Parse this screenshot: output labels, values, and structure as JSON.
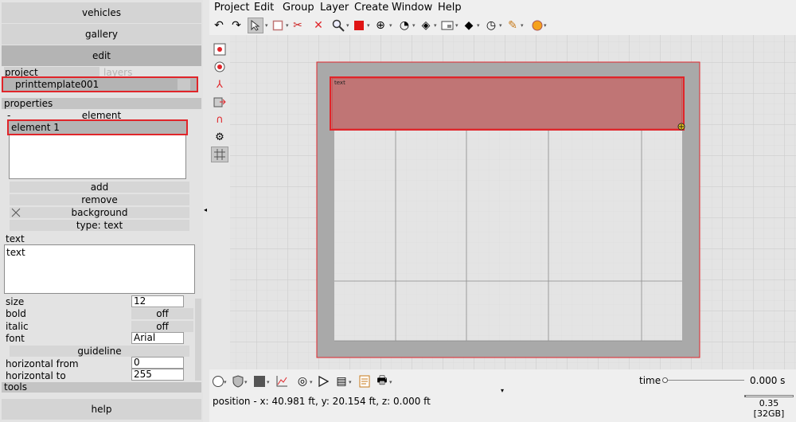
{
  "left_panel": {
    "nav": {
      "vehicles": "vehicles",
      "gallery": "gallery",
      "edit": "edit",
      "help": "help"
    },
    "tabs": {
      "project": "project",
      "layers": "layers"
    },
    "project_item": "printtemplate001",
    "properties": {
      "header": "properties",
      "element_col_prefix": "-",
      "element_col_title": "element",
      "selected_element": "element 1",
      "add_label": "add",
      "remove_label": "remove",
      "background_label": "background",
      "type_label": "type: text",
      "text_label": "text",
      "text_value": "text",
      "size_label": "size",
      "size_value": "12",
      "bold_label": "bold",
      "bold_value": "off",
      "italic_label": "italic",
      "italic_value": "off",
      "font_label": "font",
      "font_value": "Arial",
      "guideline_label": "guideline",
      "hfrom_label": "horizontal from",
      "hfrom_value": "0",
      "hto_label": "horizontal to",
      "hto_value": "255"
    },
    "tools_header": "tools"
  },
  "menu": [
    "Project",
    "Edit",
    "Group",
    "Layer",
    "Create",
    "Window",
    "Help"
  ],
  "toolbar_icons": [
    "undo-icon",
    "redo-icon",
    "select-arrow-icon",
    "rectangle-tool-icon",
    "cut-tool-icon",
    "delete-icon",
    "zoom-icon",
    "color-swatch-icon",
    "move-icon",
    "rotate-icon",
    "align-icon",
    "frame-icon",
    "ruler-icon",
    "measure-icon",
    "pencil-icon",
    "help-icon"
  ],
  "colors": {
    "accent": "#f5a11c",
    "selection_red": "#e0252a",
    "element_fill": "#c07575",
    "page_frame": "#a9a9a9"
  },
  "viewport": {
    "element_text": "text"
  },
  "bottom": {
    "time_label": "time",
    "time_value": "0.000 s",
    "position": "position - x: 40.981 ft, y: 20.154 ft, z: 0.000 ft",
    "memory_value": "0.35",
    "memory_total": "[32GB]"
  }
}
